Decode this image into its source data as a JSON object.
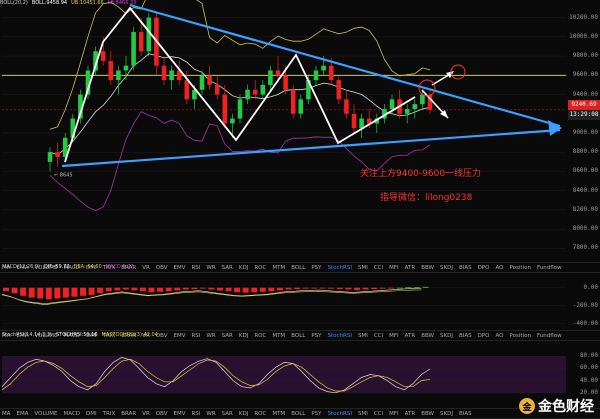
{
  "legend_main": [
    {
      "text": "BOLL(20,2)",
      "color": "#cccccc"
    },
    {
      "text": "BOLL:9458.94",
      "color": "#ffffff"
    },
    {
      "text": "UB:10451.66",
      "color": "#e0c840"
    },
    {
      "text": "LB:8466.33",
      "color": "#cc44cc"
    }
  ],
  "price_levels": [
    "10200.00",
    "10000.00",
    "9800.00",
    "9600.00",
    "9400.00",
    "9240.69",
    "9000.00",
    "8800.00",
    "8600.00",
    "8400.00",
    "8200.00",
    "8000.00",
    "7800.00"
  ],
  "current_price": "9240.69",
  "current_time": "13:29:08",
  "low_label": "8645",
  "annotation_1": "关注上方9400-9600一线压力",
  "annotation_2": "指导微信：lilong0238",
  "macd_legend": [
    {
      "text": "MACD(12,26,9)",
      "color": "#cccccc"
    },
    {
      "text": "DIF:-59.72",
      "color": "#ffffff"
    },
    {
      "text": "DEA:-64.60",
      "color": "#e0c840"
    },
    {
      "text": "MACD:9.77",
      "color": "#cc44cc"
    }
  ],
  "macd_levels": [
    "0.00",
    "-200.00",
    "-400.00"
  ],
  "stoch_legend": [
    {
      "text": "StochRSI(14,14,3,3)",
      "color": "#cccccc"
    },
    {
      "text": "STOCHRSI:59.16",
      "color": "#ffffff"
    },
    {
      "text": "MASTOCHRSI(3):42.04",
      "color": "#e0c840"
    }
  ],
  "stoch_levels": [
    "80.00",
    "60.00",
    "40.00",
    "20.00"
  ],
  "tabs_row1": [
    "MA",
    "EMA",
    "VOLUME",
    "MACD",
    "DMI",
    "TRIX",
    "BRAR",
    "VR",
    "OBV",
    "EMV",
    "RSI",
    "WR",
    "SAR",
    "KDJ",
    "ROC",
    "MTM",
    "BOLL",
    "PSY",
    "StochRSI",
    "SMI",
    "CCI",
    "MFI",
    "ATR",
    "BBW",
    "SKDJ",
    "BIAS",
    "DPO",
    "AO",
    "Position",
    "Fundflow"
  ],
  "tabs_row1_active": "StochRSI",
  "tabs_row2": [
    "MA",
    "EMA",
    "VOLUME",
    "MACD",
    "DMI",
    "TRIX",
    "BRAR",
    "VR",
    "OBV",
    "EMV",
    "RSI",
    "WR",
    "SAR",
    "KDJ",
    "ROC",
    "MTM",
    "BOLL",
    "PSY",
    "StochRSI",
    "SMI",
    "CCI",
    "MFI",
    "ATR",
    "BBW",
    "SKDJ",
    "BIAS"
  ],
  "tabs_row2_active": "StochRSI",
  "watermark_text": "金色财经",
  "watermark_logo": "金",
  "colors": {
    "up": "#22cc44",
    "down": "#ee2222",
    "trend": "#3aa0ff",
    "resist": "#e8e850"
  },
  "chart_data": {
    "type": "candlestick",
    "ylim": [
      7700,
      10300
    ],
    "resistance": 9600,
    "candles": [
      [
        8700,
        8850,
        8600,
        8800
      ],
      [
        8800,
        8900,
        8650,
        8750
      ],
      [
        8750,
        9000,
        8700,
        8950
      ],
      [
        8950,
        9200,
        8900,
        9150
      ],
      [
        9150,
        9450,
        9100,
        9400
      ],
      [
        9400,
        9700,
        9350,
        9650
      ],
      [
        9650,
        9900,
        9600,
        9850
      ],
      [
        9850,
        10000,
        9700,
        9750
      ],
      [
        9750,
        9850,
        9500,
        9550
      ],
      [
        9550,
        9700,
        9400,
        9650
      ],
      [
        9650,
        9800,
        9550,
        9700
      ],
      [
        9700,
        10100,
        9650,
        10050
      ],
      [
        10050,
        10200,
        9800,
        9850
      ],
      [
        9850,
        10250,
        9800,
        10200
      ],
      [
        10200,
        10250,
        9600,
        9700
      ],
      [
        9700,
        9800,
        9500,
        9550
      ],
      [
        9550,
        9700,
        9450,
        9650
      ],
      [
        9650,
        9750,
        9500,
        9550
      ],
      [
        9550,
        9650,
        9300,
        9350
      ],
      [
        9350,
        9500,
        9250,
        9450
      ],
      [
        9450,
        9650,
        9400,
        9600
      ],
      [
        9600,
        9700,
        9450,
        9500
      ],
      [
        9500,
        9600,
        9350,
        9400
      ],
      [
        9400,
        9500,
        9050,
        9100
      ],
      [
        9100,
        9200,
        8950,
        9150
      ],
      [
        9150,
        9400,
        9100,
        9350
      ],
      [
        9350,
        9500,
        9300,
        9450
      ],
      [
        9450,
        9550,
        9350,
        9400
      ],
      [
        9400,
        9550,
        9350,
        9500
      ],
      [
        9500,
        9700,
        9450,
        9650
      ],
      [
        9650,
        9800,
        9550,
        9600
      ],
      [
        9600,
        9700,
        9400,
        9450
      ],
      [
        9450,
        9500,
        9150,
        9200
      ],
      [
        9200,
        9400,
        9150,
        9350
      ],
      [
        9350,
        9600,
        9300,
        9550
      ],
      [
        9550,
        9700,
        9500,
        9650
      ],
      [
        9650,
        9800,
        9600,
        9700
      ],
      [
        9700,
        9780,
        9500,
        9550
      ],
      [
        9550,
        9600,
        9300,
        9350
      ],
      [
        9350,
        9450,
        9150,
        9200
      ],
      [
        9200,
        9300,
        9000,
        9050
      ],
      [
        9050,
        9200,
        8950,
        9150
      ],
      [
        9150,
        9250,
        9050,
        9100
      ],
      [
        9100,
        9200,
        9000,
        9150
      ],
      [
        9150,
        9300,
        9100,
        9250
      ],
      [
        9250,
        9400,
        9200,
        9350
      ],
      [
        9350,
        9450,
        9150,
        9200
      ],
      [
        9200,
        9300,
        9100,
        9250
      ],
      [
        9250,
        9350,
        9150,
        9300
      ],
      [
        9300,
        9450,
        9250,
        9400
      ],
      [
        9400,
        9450,
        9200,
        9240
      ]
    ],
    "macd_hist": [
      -40,
      -60,
      -90,
      -110,
      -120,
      -130,
      -120,
      -110,
      -100,
      -90,
      -80,
      -60,
      -40,
      -30,
      -20,
      -30,
      -40,
      -50,
      -45,
      -40,
      -30,
      -20,
      -15,
      -10,
      -20,
      -30,
      -40,
      -50,
      -55,
      -50,
      -45,
      -40,
      -30,
      -20,
      -15,
      -10,
      -8,
      -5,
      -10,
      -15,
      -20,
      -25,
      -20,
      -15,
      -10,
      -5,
      0,
      5,
      8,
      10
    ],
    "stoch_k": [
      30,
      45,
      60,
      70,
      75,
      72,
      65,
      55,
      40,
      30,
      25,
      35,
      55,
      70,
      78,
      74,
      60,
      45,
      35,
      30,
      40,
      55,
      65,
      72,
      76,
      70,
      55,
      40,
      30,
      28,
      35,
      50,
      62,
      70,
      68,
      55,
      40,
      28,
      22,
      20,
      25,
      35,
      45,
      50,
      48,
      40,
      30,
      25,
      35,
      50,
      59
    ],
    "stoch_d": [
      25,
      35,
      50,
      62,
      70,
      72,
      68,
      60,
      48,
      38,
      30,
      32,
      45,
      60,
      72,
      75,
      68,
      55,
      45,
      38,
      38,
      48,
      58,
      68,
      74,
      72,
      62,
      48,
      38,
      32,
      33,
      42,
      55,
      64,
      68,
      62,
      50,
      38,
      28,
      23,
      23,
      30,
      38,
      45,
      48,
      45,
      38,
      30,
      30,
      40,
      42
    ]
  }
}
